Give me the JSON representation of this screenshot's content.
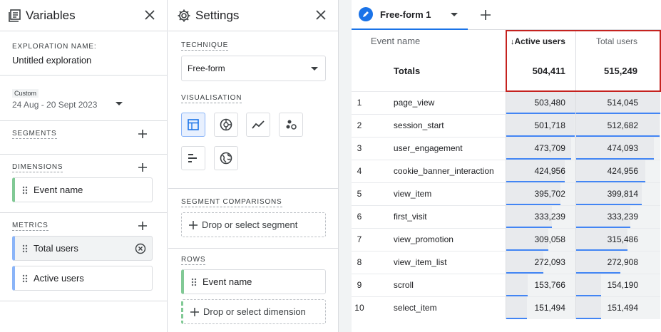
{
  "variables": {
    "title": "Variables",
    "exploration_label": "EXPLORATION NAME:",
    "exploration_name": "Untitled exploration",
    "date_badge": "Custom",
    "date_range": "24 Aug - 20 Sept 2023",
    "segments_label": "SEGMENTS",
    "dimensions_label": "DIMENSIONS",
    "dimensions": [
      "Event name"
    ],
    "metrics_label": "METRICS",
    "metrics": [
      "Total users",
      "Active users"
    ]
  },
  "settings": {
    "title": "Settings",
    "technique_label": "TECHNIQUE",
    "technique_value": "Free-form",
    "visualisation_label": "VISUALISATION",
    "visualisations": [
      "table-icon",
      "donut-chart-icon",
      "line-chart-icon",
      "scatter-chart-icon",
      "bar-chart-icon",
      "globe-icon"
    ],
    "segment_comparisons_label": "SEGMENT COMPARISONS",
    "segment_drop": "Drop or select segment",
    "rows_label": "ROWS",
    "rows": [
      "Event name"
    ],
    "rows_drop": "Drop or select dimension"
  },
  "main": {
    "tab_label": "Free-form 1",
    "columns": {
      "event": "Event name",
      "active": "Active users",
      "total": "Total users"
    },
    "totals_label": "Totals",
    "totals": {
      "active": "504,411",
      "total": "515,249"
    },
    "rows": [
      {
        "idx": "1",
        "event": "page_view",
        "active": "503,480",
        "total": "514,045",
        "active_frac": 0.998,
        "total_frac": 0.998
      },
      {
        "idx": "2",
        "event": "session_start",
        "active": "501,718",
        "total": "512,682",
        "active_frac": 0.995,
        "total_frac": 0.995
      },
      {
        "idx": "3",
        "event": "user_engagement",
        "active": "473,709",
        "total": "474,093",
        "active_frac": 0.939,
        "total_frac": 0.92
      },
      {
        "idx": "4",
        "event": "cookie_banner_interaction",
        "active": "424,956",
        "total": "424,956",
        "active_frac": 0.842,
        "total_frac": 0.825
      },
      {
        "idx": "5",
        "event": "view_item",
        "active": "395,702",
        "total": "399,814",
        "active_frac": 0.784,
        "total_frac": 0.776
      },
      {
        "idx": "6",
        "event": "first_visit",
        "active": "333,239",
        "total": "333,239",
        "active_frac": 0.661,
        "total_frac": 0.647
      },
      {
        "idx": "7",
        "event": "view_promotion",
        "active": "309,058",
        "total": "315,486",
        "active_frac": 0.613,
        "total_frac": 0.612
      },
      {
        "idx": "8",
        "event": "view_item_list",
        "active": "272,093",
        "total": "272,908",
        "active_frac": 0.539,
        "total_frac": 0.53
      },
      {
        "idx": "9",
        "event": "scroll",
        "active": "153,766",
        "total": "154,190",
        "active_frac": 0.305,
        "total_frac": 0.299
      },
      {
        "idx": "10",
        "event": "select_item",
        "active": "151,494",
        "total": "151,494",
        "active_frac": 0.3,
        "total_frac": 0.294
      }
    ]
  },
  "colors": {
    "accent": "#1a73e8",
    "highlight": "#c5221f",
    "dimension": "#81c995",
    "metric": "#8ab4f8"
  }
}
